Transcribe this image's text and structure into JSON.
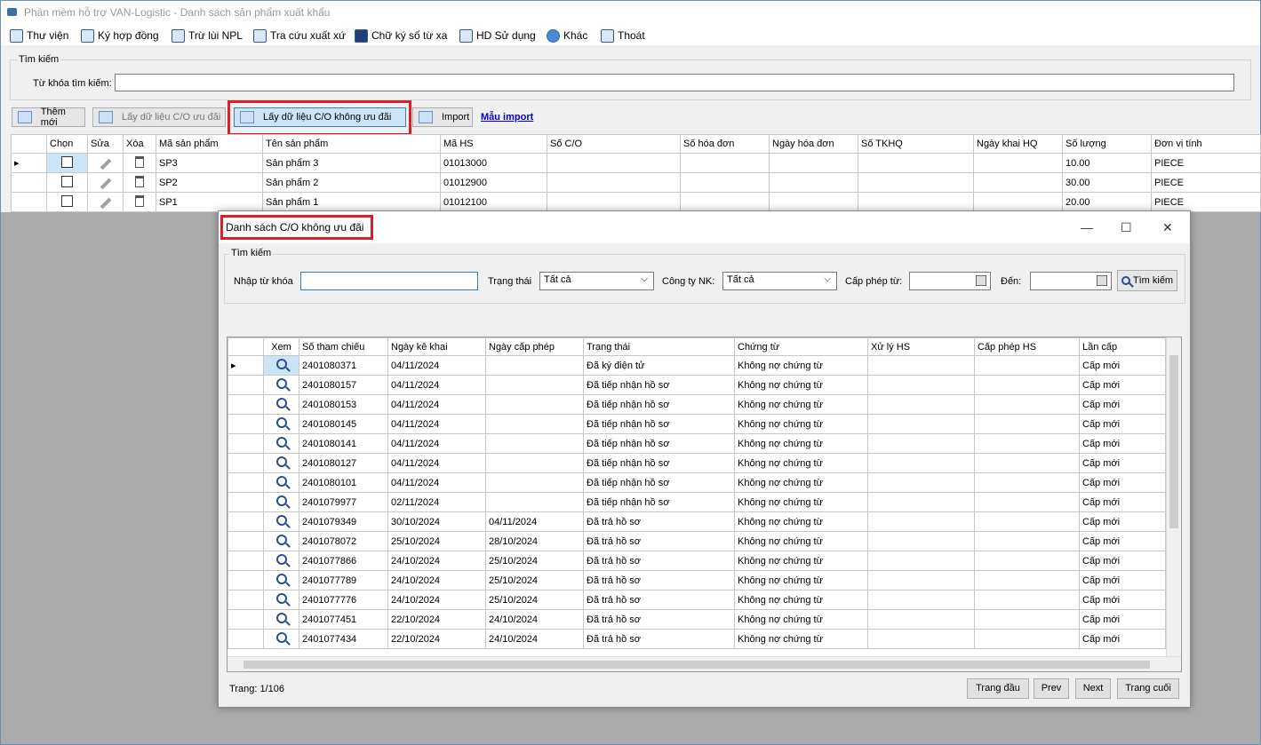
{
  "window": {
    "title": "Phần mềm hỗ trợ VAN-Logistic - Danh sách sản phẩm xuất khẩu"
  },
  "menu": [
    {
      "label": "Thư viện",
      "icon": "book-icon"
    },
    {
      "label": "Ký hợp đồng",
      "icon": "sign-icon"
    },
    {
      "label": "Trừ lùi NPL",
      "icon": "search-doc-icon"
    },
    {
      "label": "Tra cứu xuất xứ",
      "icon": "lookup-icon"
    },
    {
      "label": "Chữ ký số từ xa",
      "icon": "lock-icon"
    },
    {
      "label": "HD Sử dụng",
      "icon": "info-icon"
    },
    {
      "label": "Khác",
      "icon": "gear-icon"
    },
    {
      "label": "Thoát",
      "icon": "exit-icon"
    }
  ],
  "search": {
    "group_label": "Tìm kiếm",
    "keyword_label": "Từ khóa tìm kiếm:",
    "keyword_value": ""
  },
  "toolbar": {
    "add_label": "Thêm mới",
    "get_preferential_label": "Lấy dữ liệu C/O ưu đãi",
    "get_non_preferential_label": "Lấy dữ liệu C/O không ưu đãi",
    "import_label": "Import",
    "import_template_label": "Mẫu import"
  },
  "products": {
    "columns": [
      "Chọn",
      "Sửa",
      "Xóa",
      "Mã sản phẩm",
      "Tên sản phẩm",
      "Mã HS",
      "Số C/O",
      "Số hóa đơn",
      "Ngày hóa đơn",
      "Số TKHQ",
      "Ngày khai HQ",
      "Số lượng",
      "Đơn vị tính"
    ],
    "rows": [
      {
        "code": "SP3",
        "name": "Sản phẩm 3",
        "hs": "01013000",
        "qty": "10.00",
        "unit": "PIECE"
      },
      {
        "code": "SP2",
        "name": "Sản phẩm 2",
        "hs": "01012900",
        "qty": "30.00",
        "unit": "PIECE"
      },
      {
        "code": "SP1",
        "name": "Sản phẩm 1",
        "hs": "01012100",
        "qty": "20.00",
        "unit": "PIECE"
      }
    ]
  },
  "dialog": {
    "title": "Danh sách C/O không ưu đãi",
    "search_group": "Tìm kiếm",
    "keyword_label": "Nhập từ khóa",
    "keyword_value": "",
    "status_label": "Trạng thái",
    "status_value": "Tất cả",
    "company_label": "Công ty NK:",
    "company_value": "Tất cả",
    "from_label": "Cấp phép từ:",
    "to_label": "Đến:",
    "search_button": "Tìm kiếm",
    "columns": [
      "Xem",
      "Số tham chiếu",
      "Ngày kê khai",
      "Ngày cấp phép",
      "Trạng thái",
      "Chứng từ",
      "Xử lý HS",
      "Cấp phép HS",
      "Lần cấp"
    ],
    "rows": [
      {
        "ref": "2401080371",
        "decl": "04/11/2024",
        "lic": "",
        "status": "Đã ký điện tử",
        "doc": "Không nợ chứng từ",
        "times": "Cấp mới"
      },
      {
        "ref": "2401080157",
        "decl": "04/11/2024",
        "lic": "",
        "status": "Đã tiếp nhận hồ sơ",
        "doc": "Không nợ chứng từ",
        "times": "Cấp mới"
      },
      {
        "ref": "2401080153",
        "decl": "04/11/2024",
        "lic": "",
        "status": "Đã tiếp nhận hồ sơ",
        "doc": "Không nợ chứng từ",
        "times": "Cấp mới"
      },
      {
        "ref": "2401080145",
        "decl": "04/11/2024",
        "lic": "",
        "status": "Đã tiếp nhận hồ sơ",
        "doc": "Không nợ chứng từ",
        "times": "Cấp mới"
      },
      {
        "ref": "2401080141",
        "decl": "04/11/2024",
        "lic": "",
        "status": "Đã tiếp nhận hồ sơ",
        "doc": "Không nợ chứng từ",
        "times": "Cấp mới"
      },
      {
        "ref": "2401080127",
        "decl": "04/11/2024",
        "lic": "",
        "status": "Đã tiếp nhận hồ sơ",
        "doc": "Không nợ chứng từ",
        "times": "Cấp mới"
      },
      {
        "ref": "2401080101",
        "decl": "04/11/2024",
        "lic": "",
        "status": "Đã tiếp nhận hồ sơ",
        "doc": "Không nợ chứng từ",
        "times": "Cấp mới"
      },
      {
        "ref": "2401079977",
        "decl": "02/11/2024",
        "lic": "",
        "status": "Đã tiếp nhận hồ sơ",
        "doc": "Không nợ chứng từ",
        "times": "Cấp mới"
      },
      {
        "ref": "2401079349",
        "decl": "30/10/2024",
        "lic": "04/11/2024",
        "status": "Đã trả hồ sơ",
        "doc": "Không nợ chứng từ",
        "times": "Cấp mới"
      },
      {
        "ref": "2401078072",
        "decl": "25/10/2024",
        "lic": "28/10/2024",
        "status": "Đã trả hồ sơ",
        "doc": "Không nợ chứng từ",
        "times": "Cấp mới"
      },
      {
        "ref": "2401077866",
        "decl": "24/10/2024",
        "lic": "25/10/2024",
        "status": "Đã trả hồ sơ",
        "doc": "Không nợ chứng từ",
        "times": "Cấp mới"
      },
      {
        "ref": "2401077789",
        "decl": "24/10/2024",
        "lic": "25/10/2024",
        "status": "Đã trả hồ sơ",
        "doc": "Không nợ chứng từ",
        "times": "Cấp mới"
      },
      {
        "ref": "2401077776",
        "decl": "24/10/2024",
        "lic": "25/10/2024",
        "status": "Đã trả hồ sơ",
        "doc": "Không nợ chứng từ",
        "times": "Cấp mới"
      },
      {
        "ref": "2401077451",
        "decl": "22/10/2024",
        "lic": "24/10/2024",
        "status": "Đã trả hồ sơ",
        "doc": "Không nợ chứng từ",
        "times": "Cấp mới"
      },
      {
        "ref": "2401077434",
        "decl": "22/10/2024",
        "lic": "24/10/2024",
        "status": "Đã trả hồ sơ",
        "doc": "Không nợ chứng từ",
        "times": "Cấp mới"
      }
    ],
    "page_label": "Trang: 1/106",
    "first_label": "Trang đầu",
    "prev_label": "Prev",
    "next_label": "Next",
    "last_label": "Trang cuối"
  },
  "colors": {
    "highlight": "#d3222a",
    "accent": "#1f3f7a"
  }
}
